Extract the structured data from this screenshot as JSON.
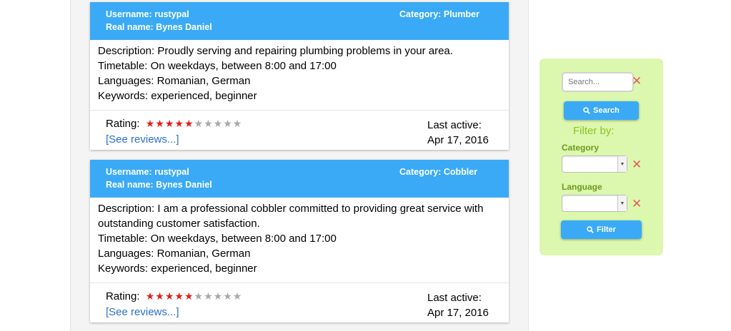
{
  "listings": [
    {
      "username_label": "Username: rustypal",
      "realname_label": "Real name: Bynes Daniel",
      "category_label": "Category: Plumber",
      "description": "Description: Proudly serving and repairing plumbing problems in your area.",
      "timetable": "Timetable: On weekdays, between 8:00 and 17:00",
      "languages": "Languages: Romanian, German",
      "keywords": "Keywords: experienced, beginner",
      "rating_label": "Rating:",
      "rating_value": 5,
      "rating_max": 10,
      "reviews_link": "[See reviews...]",
      "last_active_label": "Last active:",
      "last_active_date": "Apr 17, 2016"
    },
    {
      "username_label": "Username: rustypal",
      "realname_label": "Real name: Bynes Daniel",
      "category_label": "Category: Cobbler",
      "description": "Description: I am a professional cobbler committed to providing great service with outstanding customer satisfaction.",
      "timetable": "Timetable: On weekdays, between 8:00 and 17:00",
      "languages": "Languages: Romanian, German",
      "keywords": "Keywords: experienced, beginner",
      "rating_label": "Rating:",
      "rating_value": 5,
      "rating_max": 10,
      "reviews_link": "[See reviews...]",
      "last_active_label": "Last active:",
      "last_active_date": "Apr 17, 2016"
    }
  ],
  "filter": {
    "search_placeholder": "Search...",
    "search_button": "Search",
    "filter_by_title": "Filter by:",
    "category_label": "Category",
    "category_value": "",
    "language_label": "Language",
    "language_value": "",
    "filter_button": "Filter"
  },
  "icons": {
    "search": "magnifier-icon",
    "clear": "close-icon",
    "star": "star-icon",
    "dropdown": "chevron-down-icon"
  },
  "colors": {
    "header_blue": "#3aaaf6",
    "panel_green": "#dcf7ae",
    "star_active": "#e21c1c",
    "star_inactive": "#a8a8a8",
    "link": "#2b72c8",
    "clear_red": "#e45b5b"
  }
}
